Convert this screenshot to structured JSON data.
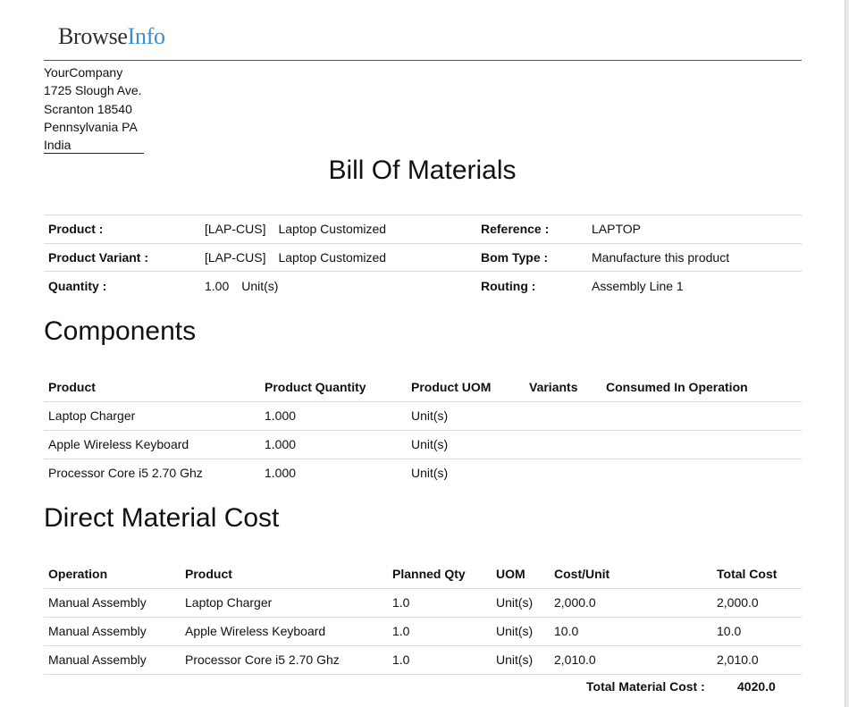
{
  "logo": {
    "part1": "Browse",
    "part2": "Info",
    "accent_color": "#3a8fcf"
  },
  "company": {
    "lines": [
      "YourCompany",
      "1725 Slough Ave.",
      "Scranton 18540",
      "Pennsylvania PA",
      "India"
    ]
  },
  "title": "Bill Of Materials",
  "info": {
    "product_label": "Product :",
    "product_code": "[LAP-CUS]",
    "product_name": "Laptop Customized",
    "variant_label": "Product Variant :",
    "variant_code": "[LAP-CUS]",
    "variant_name": "Laptop Customized",
    "quantity_label": "Quantity :",
    "quantity_value": "1.00",
    "quantity_uom": "Unit(s)",
    "reference_label": "Reference :",
    "reference_value": "LAPTOP",
    "bom_type_label": "Bom Type :",
    "bom_type_value": "Manufacture this product",
    "routing_label": "Routing :",
    "routing_value": "Assembly Line 1"
  },
  "components": {
    "heading": "Components",
    "headers": [
      "Product",
      "Product Quantity",
      "Product UOM",
      "Variants",
      "Consumed In Operation"
    ],
    "rows": [
      [
        "Laptop Charger",
        "1.000",
        "Unit(s)",
        "",
        ""
      ],
      [
        "Apple Wireless Keyboard",
        "1.000",
        "Unit(s)",
        "",
        ""
      ],
      [
        "Processor Core i5 2.70 Ghz",
        "1.000",
        "Unit(s)",
        "",
        ""
      ]
    ]
  },
  "direct_cost": {
    "heading": "Direct Material Cost",
    "headers": [
      "Operation",
      "Product",
      "Planned Qty",
      "UOM",
      "Cost/Unit",
      "Total Cost"
    ],
    "rows": [
      [
        "Manual Assembly",
        "Laptop Charger",
        "1.0",
        "Unit(s)",
        "2,000.0",
        "2,000.0"
      ],
      [
        "Manual Assembly",
        "Apple Wireless Keyboard",
        "1.0",
        "Unit(s)",
        "10.0",
        "10.0"
      ],
      [
        "Manual Assembly",
        "Processor Core i5 2.70 Ghz",
        "1.0",
        "Unit(s)",
        "2,010.0",
        "2,010.0"
      ]
    ],
    "total_label": "Total Material Cost :",
    "total_value": "4020.0"
  }
}
